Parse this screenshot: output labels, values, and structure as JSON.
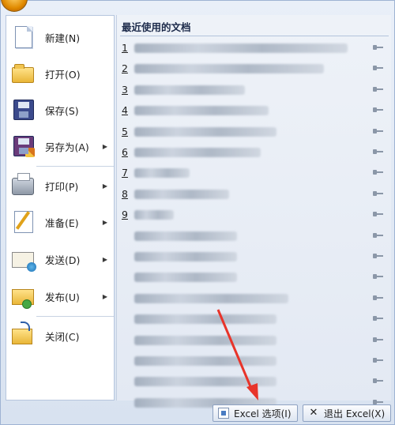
{
  "menu": {
    "commands": [
      {
        "label": "新建(N)",
        "icon": "new-document-icon",
        "has_submenu": false
      },
      {
        "label": "打开(O)",
        "icon": "open-folder-icon",
        "has_submenu": false
      },
      {
        "label": "保存(S)",
        "icon": "save-disk-icon",
        "has_submenu": false
      },
      {
        "label": "另存为(A)",
        "icon": "save-as-icon",
        "has_submenu": true
      },
      {
        "label": "打印(P)",
        "icon": "printer-icon",
        "has_submenu": true
      },
      {
        "label": "准备(E)",
        "icon": "prepare-icon",
        "has_submenu": true
      },
      {
        "label": "发送(D)",
        "icon": "send-icon",
        "has_submenu": true
      },
      {
        "label": "发布(U)",
        "icon": "publish-icon",
        "has_submenu": true
      },
      {
        "label": "关闭(C)",
        "icon": "close-folder-icon",
        "has_submenu": false
      }
    ],
    "submenu_arrow": "▶"
  },
  "recent": {
    "title": "最近使用的文档",
    "numbers": [
      "1",
      "2",
      "3",
      "4",
      "5",
      "6",
      "7",
      "8",
      "9"
    ],
    "row_count": 18
  },
  "buttons": {
    "options": "Excel 选项(I)",
    "exit": "退出 Excel(X)",
    "exit_icon": "✕"
  },
  "colors": {
    "annotation": "#e8342a",
    "accent": "#3b4a8c"
  }
}
